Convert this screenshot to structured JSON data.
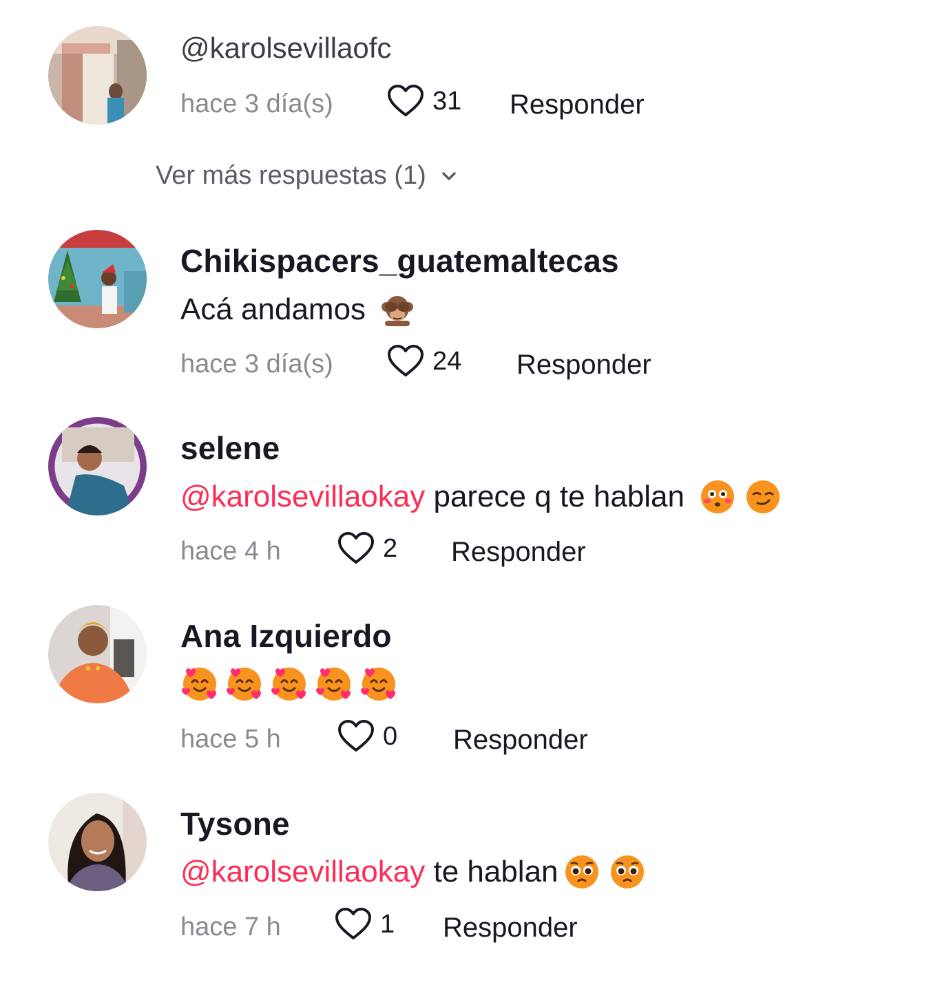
{
  "comments": [
    {
      "mention_line": "@karolsevillaofc",
      "time": "hace 3 día(s)",
      "likes": "31",
      "reply_label": "Responder"
    },
    {
      "username": "Chikispacers_guatemaltecas",
      "text": "Acá andamos",
      "emoji": "see-no-evil-monkey-icon",
      "time": "hace 3 día(s)",
      "likes": "24",
      "reply_label": "Responder"
    },
    {
      "username": "selene",
      "mention": "@karolsevillaokay",
      "text": " parece q te hablan",
      "time": "hace 4 h",
      "likes": "2",
      "reply_label": "Responder"
    },
    {
      "username": "Ana Izquierdo",
      "time": "hace 5 h",
      "likes": "0",
      "reply_label": "Responder"
    },
    {
      "username": "Tysone",
      "mention": "@karolsevillaokay",
      "text": " te hablan",
      "time": "hace 7 h",
      "likes": "1",
      "reply_label": "Responder"
    }
  ],
  "view_more_replies": "Ver más respuestas (1)",
  "colors": {
    "mention": "#fe2c55",
    "text": "#161823",
    "muted": "#8a8b91"
  }
}
